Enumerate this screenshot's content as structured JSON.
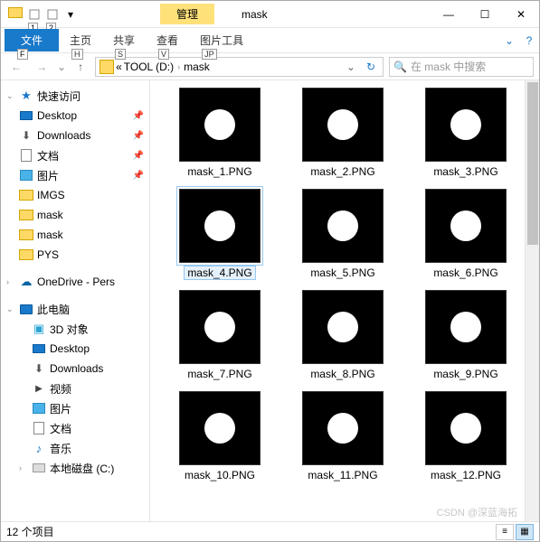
{
  "titlebar": {
    "qat": {
      "k1": "1",
      "k2": "2"
    },
    "manage_tab": "管理",
    "title": "mask",
    "min": "—",
    "max": "☐",
    "close": "✕"
  },
  "ribbon": {
    "file": "文件",
    "file_key": "F",
    "home": "主页",
    "home_key": "H",
    "share": "共享",
    "share_key": "S",
    "view": "查看",
    "view_key": "V",
    "pic_tools": "图片工具",
    "pic_key": "JP",
    "expand": "⌄",
    "help": "?"
  },
  "addrbar": {
    "back": "←",
    "fwd": "→",
    "up": "↑",
    "sep": "«",
    "part1": "TOOL (D:)",
    "part2": "mask",
    "chev": "›",
    "drop": "⌄",
    "refresh": "↻",
    "search_placeholder": "在 mask 中搜索",
    "search_icon": "🔍"
  },
  "sidebar": {
    "quick_access": "快速访问",
    "desktop": "Desktop",
    "downloads": "Downloads",
    "documents": "文档",
    "pictures": "图片",
    "imgs": "IMGS",
    "mask": "mask",
    "mask2": "mask",
    "pys": "PYS",
    "onedrive": "OneDrive - Pers",
    "this_pc": "此电脑",
    "obj3d": "3D 对象",
    "desktop2": "Desktop",
    "downloads2": "Downloads",
    "videos": "视频",
    "pictures2": "图片",
    "documents2": "文档",
    "music": "音乐",
    "disk_c": "本地磁盘 (C:)",
    "pin": "📌"
  },
  "files": [
    {
      "name": "mask_1.PNG",
      "selected": false
    },
    {
      "name": "mask_2.PNG",
      "selected": false
    },
    {
      "name": "mask_3.PNG",
      "selected": false
    },
    {
      "name": "mask_4.PNG",
      "selected": true
    },
    {
      "name": "mask_5.PNG",
      "selected": false
    },
    {
      "name": "mask_6.PNG",
      "selected": false
    },
    {
      "name": "mask_7.PNG",
      "selected": false
    },
    {
      "name": "mask_8.PNG",
      "selected": false
    },
    {
      "name": "mask_9.PNG",
      "selected": false
    },
    {
      "name": "mask_10.PNG",
      "selected": false
    },
    {
      "name": "mask_11.PNG",
      "selected": false
    },
    {
      "name": "mask_12.PNG",
      "selected": false
    }
  ],
  "statusbar": {
    "count": "12 个项目",
    "view_details": "≡",
    "view_icons": "▦"
  },
  "watermark": "CSDN @深蓝海拓"
}
